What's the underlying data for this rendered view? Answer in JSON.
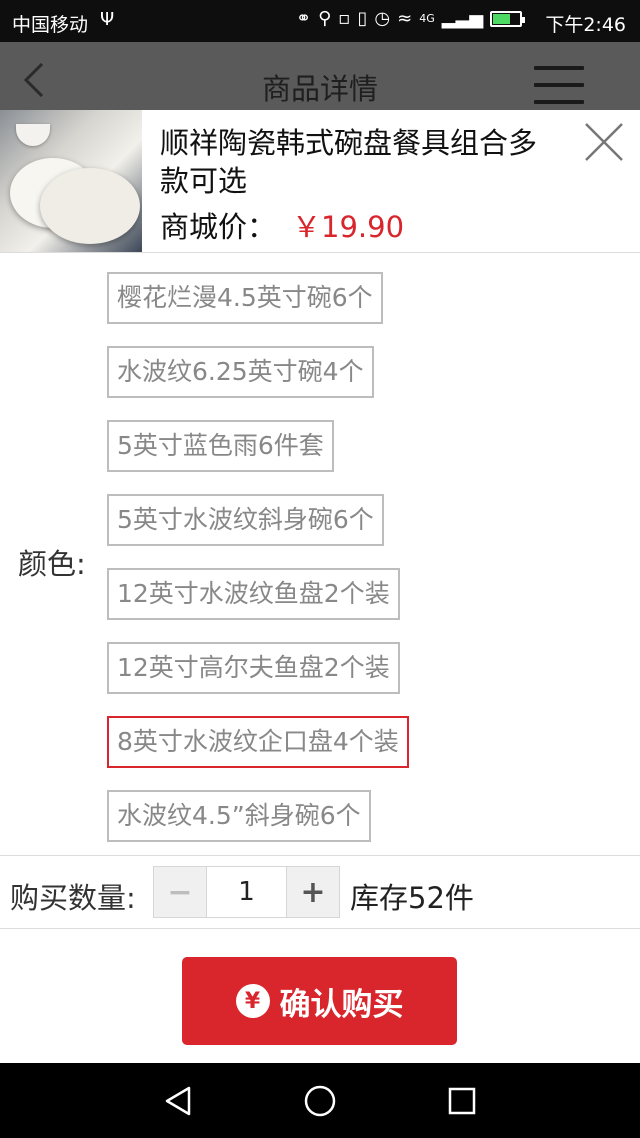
{
  "status_bar": {
    "carrier": "中国移动",
    "network": "4G",
    "time": "下午2:46",
    "battery_level": 0.6
  },
  "header": {
    "title": "商品详情",
    "back_icon": "chevron-left-icon",
    "menu_icon": "hamburger-menu-icon"
  },
  "product": {
    "name": "顺祥陶瓷韩式碗盘餐具组合多款可选",
    "price_label": "商城价：",
    "price": "￥19.90",
    "close_icon": "close-icon"
  },
  "color": {
    "label": "颜色:",
    "options": [
      "樱花烂漫4.5英寸碗6个",
      "水波纹6.25英寸碗4个",
      "5英寸蓝色雨6件套",
      "5英寸水波纹斜身碗6个",
      "12英寸水波纹鱼盘2个装",
      "12英寸高尔夫鱼盘2个装",
      "8英寸水波纹企口盘4个装",
      "水波纹4.5”斜身碗6个"
    ],
    "selected_index": 6
  },
  "quantity": {
    "label": "购买数量:",
    "minus": "−",
    "value": "1",
    "plus": "+",
    "stock": "库存52件"
  },
  "buy_button": {
    "icon_glyph": "¥",
    "label": "确认购买"
  },
  "colors": {
    "accent": "#d8262c",
    "navbar": "#5a5a5a",
    "statusbar": "#0e0e0e"
  }
}
